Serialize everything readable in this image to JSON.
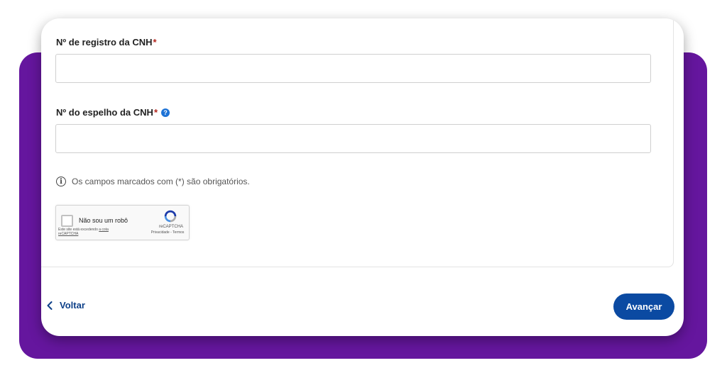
{
  "form": {
    "cnh_registration": {
      "label": "Nº de registro da CNH",
      "required_mark": "*",
      "value": ""
    },
    "cnh_mirror": {
      "label": "Nº do espelho da CNH",
      "required_mark": "*",
      "value": "",
      "help_icon": "?"
    },
    "required_note": "Os campos marcados com (*) são obrigatórios.",
    "info_icon": "i"
  },
  "recaptcha": {
    "label": "Não sou um robô",
    "quota_text": "Este site está excedendo",
    "quota_link": "a cota reCAPTCHA",
    "brand": "reCAPTCHA",
    "links": "Privacidade - Termos"
  },
  "footer": {
    "back_label": "Voltar",
    "next_label": "Avançar"
  },
  "colors": {
    "background_accent": "#65169e",
    "primary_button": "#0b4aa2",
    "link": "#0c3f88",
    "required": "#b3261e"
  }
}
